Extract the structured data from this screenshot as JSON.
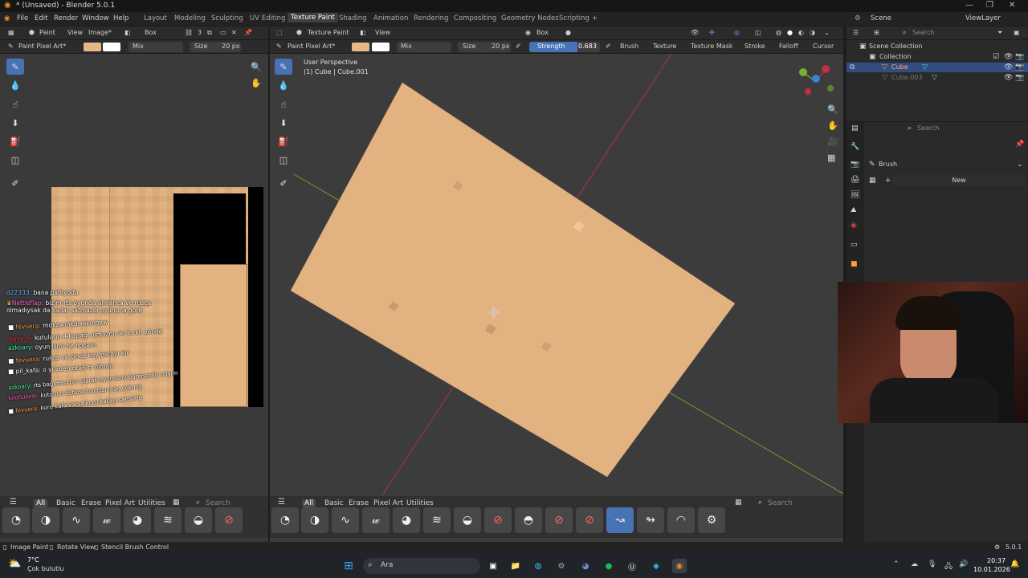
{
  "window": {
    "title": "* (Unsaved) - Blender 5.0.1",
    "min": "—",
    "max": "❐",
    "close": "✕"
  },
  "menu": {
    "items": [
      "File",
      "Edit",
      "Render",
      "Window",
      "Help"
    ],
    "workspaces": [
      "Layout",
      "Modeling",
      "Sculpting",
      "UV Editing",
      "Texture Paint",
      "Shading",
      "Animation",
      "Rendering",
      "Compositing",
      "Geometry Nodes",
      "Scripting"
    ],
    "active_workspace": "Texture Paint",
    "add": "+"
  },
  "scene": {
    "label": "Scene",
    "view_layer": "ViewLayer"
  },
  "image_editor": {
    "header": {
      "mode": "Paint",
      "view": "View",
      "image": "Image*",
      "box": "Box",
      "users": "3"
    },
    "tool_header": {
      "brush": "Paint Pixel Art*",
      "blend": "Mix",
      "size_label": "Size",
      "size_value": "20 px"
    },
    "brush_tabs": [
      "All",
      "Basic",
      "Erase",
      "Pixel Art",
      "Utilities"
    ],
    "search_placeholder": "Search"
  },
  "viewport": {
    "header": {
      "mode": "Texture Paint",
      "view": "View",
      "box": "Box"
    },
    "tool_header": {
      "brush": "Paint Pixel Art*",
      "blend": "Mix",
      "size_label": "Size",
      "size_value": "20 px",
      "strength_label": "Strength",
      "strength_value": "0.683",
      "strength_fraction": 0.683,
      "menus": [
        "Brush",
        "Texture",
        "Texture Mask",
        "Stroke",
        "Falloff",
        "Cursor"
      ]
    },
    "overlay": {
      "perspective": "User Perspective",
      "object": "(1) Cube | Cube.001"
    },
    "brush_tabs": [
      "All",
      "Basic",
      "Erase",
      "Pixel Art",
      "Utilities"
    ],
    "search_placeholder": "Search"
  },
  "outliner": {
    "search_placeholder": "Search",
    "root": "Scene Collection",
    "collection": "Collection",
    "objects": [
      "Cube",
      "Cube.003"
    ]
  },
  "properties": {
    "search_placeholder": "Search",
    "panel": "Brush",
    "new_button": "New"
  },
  "chat": [
    {
      "user": "d22333:",
      "msg": "bana patlıyodu",
      "color": "#6fb7ff"
    },
    {
      "user": "Nettleflap:",
      "msg": "bizim rts oyunda almanca ve rusça olmadıysak da kadar satmazdı oyununa göre",
      "color": "#ff6bd6"
    },
    {
      "user": "fevuera:",
      "msg": "mdkawmkdwakmoaw",
      "color": "#ffa24a"
    },
    {
      "user": "Yaniv_S:",
      "msg": "kutuların 4 kapağı olmazmı iki farklı yönde",
      "color": "#ff3b3b"
    },
    {
      "user": "azkoary:",
      "msg": "oyun ismi ne hocam",
      "color": "#3dffa2"
    },
    {
      "user": "fevuera:",
      "msg": "rusça ve çince koy parayı kır",
      "color": "#ffa24a"
    },
    {
      "user": "pil_kafa:",
      "msg": "o yüzden gta6 tr olmalı",
      "color": "#cfcfcf"
    },
    {
      "user": "azkoary:",
      "msg": "rts bağımlısı biri olarak oyun ismi öğrenebilir miyım",
      "color": "#3dffa2"
    },
    {
      "user": "kilotlukedi:",
      "msg": "kutunun üstüne banttan naç çekmiş",
      "color": "#ff5fc4"
    },
    {
      "user": "fevuera:",
      "msg": "kuru kafa varsa kuru kafayı sansürle",
      "color": "#ffa24a"
    }
  ],
  "status": {
    "items": [
      "Image Paint",
      "Rotate View",
      "Stencil Brush Control"
    ],
    "version": "5.0.1"
  },
  "taskbar": {
    "weather_temp": "7°C",
    "weather_desc": "Çok bulutlu",
    "search": "Ara",
    "time": "20:37",
    "date": "10.01.2026"
  },
  "colors": {
    "accent": "#4772b3",
    "paint_primary": "#e6b887",
    "paint_secondary": "#ffffff",
    "texture": "#e2b280"
  }
}
